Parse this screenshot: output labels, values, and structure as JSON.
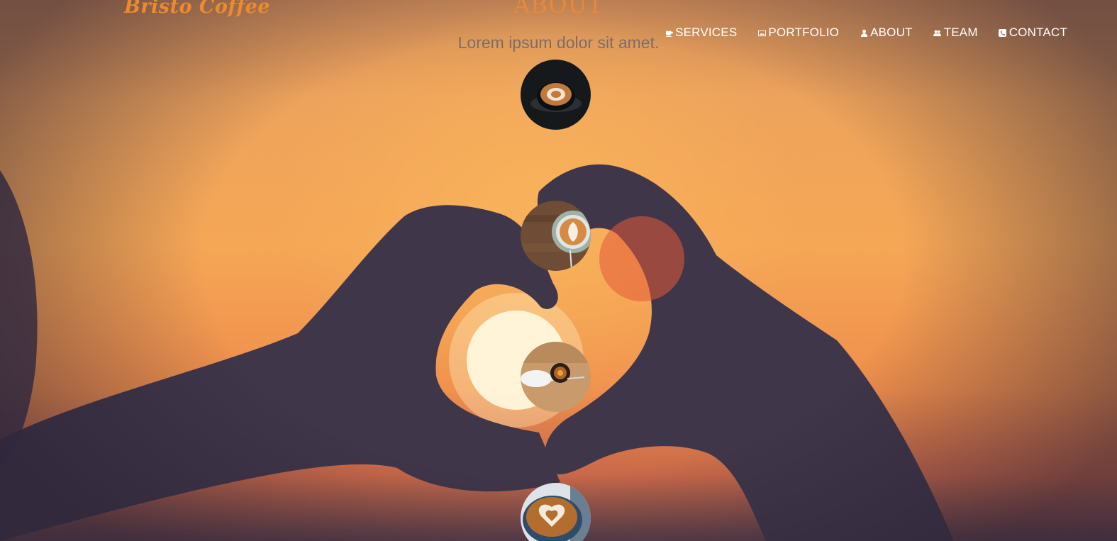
{
  "header": {
    "logo": "Bristo Coffee",
    "nav": [
      {
        "label": "SERVICES",
        "icon": "coffee-icon"
      },
      {
        "label": "PORTFOLIO",
        "icon": "image-icon"
      },
      {
        "label": "ABOUT",
        "icon": "user-icon"
      },
      {
        "label": "TEAM",
        "icon": "users-icon"
      },
      {
        "label": "CONTACT",
        "icon": "phone-icon"
      }
    ]
  },
  "about": {
    "title": "ABOUT",
    "subtitle": "Lorem ipsum dolor sit amet.",
    "timeline_images": [
      {
        "icon": "latte-art-cup-photo"
      },
      {
        "icon": "rosetta-latte-photo"
      },
      {
        "icon": "pour-over-coffee-photo"
      },
      {
        "icon": "heart-latte-photo"
      }
    ]
  },
  "colors": {
    "brand": "#ee8a2e",
    "nav_text": "#ffffff",
    "subtitle": "#7c6c6d"
  }
}
